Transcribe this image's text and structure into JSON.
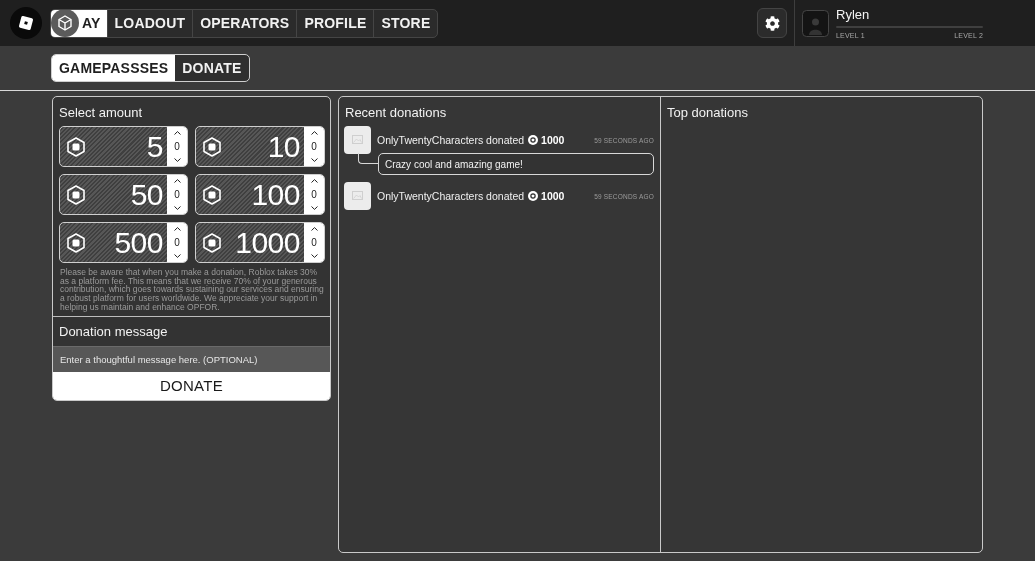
{
  "top_bar": {
    "nav_tabs": [
      {
        "label": "AY",
        "selected": true
      },
      {
        "label": "LOADOUT",
        "selected": false
      },
      {
        "label": "OPERATORS",
        "selected": false
      },
      {
        "label": "PROFILE",
        "selected": false
      },
      {
        "label": "STORE",
        "selected": false
      }
    ],
    "profile": {
      "name": "Rylen",
      "level_from": "LEVEL 1",
      "level_to": "LEVEL 2"
    }
  },
  "sub_tabs": [
    {
      "label": "GAMEPASSSES",
      "selected": true
    },
    {
      "label": "DONATE",
      "selected": false
    }
  ],
  "donate_panel": {
    "title": "Select amount",
    "amounts": [
      {
        "value": "5",
        "quantity": "0"
      },
      {
        "value": "10",
        "quantity": "0"
      },
      {
        "value": "50",
        "quantity": "0"
      },
      {
        "value": "100",
        "quantity": "0"
      },
      {
        "value": "500",
        "quantity": "0"
      },
      {
        "value": "1000",
        "quantity": "0"
      }
    ],
    "disclaimer": "Please be aware that when you make a donation, Roblox takes 30% as a platform fee. This means that we receive 70% of your generous contribution, which goes towards sustaining our services and ensuring a robust platform for users worldwide. We appreciate your support in helping us maintain and enhance OPFOR.",
    "message_title": "Donation message",
    "message_field": {
      "placeholder": "Enter a thoughtful message here. (OPTIONAL)"
    },
    "button": "DONATE"
  },
  "recent_donations": {
    "title": "Recent donations",
    "items": [
      {
        "text": "OnlyTwentyCharacters donated",
        "amount": "1000",
        "time": "59 SECONDS AGO",
        "message": "Crazy cool and amazing game!"
      },
      {
        "text": "OnlyTwentyCharacters donated",
        "amount": "1000",
        "time": "59 SECONDS AGO"
      }
    ]
  },
  "top_donations": {
    "title": "Top donations"
  }
}
